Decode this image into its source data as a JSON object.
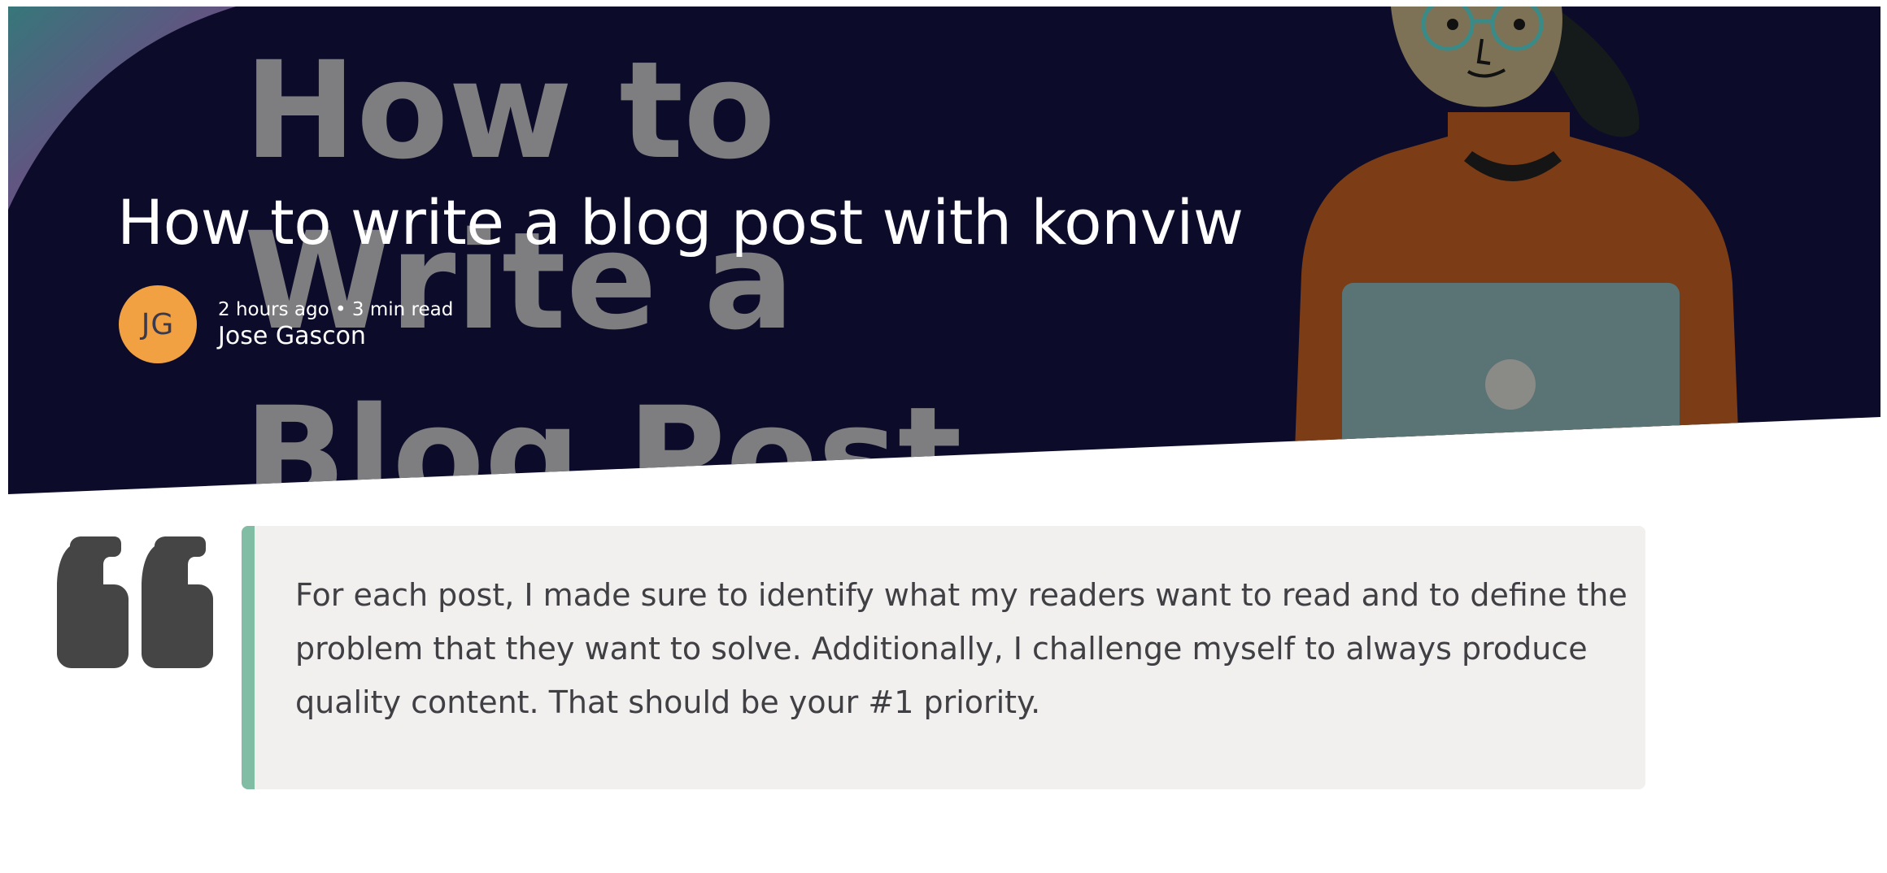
{
  "hero": {
    "background_image_text": [
      "How to",
      "Write a",
      "Blog Post"
    ],
    "title": "How to write a blog post with konviw",
    "background_color": "#0c0c2a"
  },
  "author": {
    "initials": "JG",
    "meta": "2 hours ago • 3 min read",
    "name": "Jose Gascon",
    "avatar_color": "#f2a142"
  },
  "quote": {
    "icon": "quote-icon",
    "text": "For each post, I made sure to identify what my readers want to read and to define the problem that they want to solve. Additionally, I challenge myself to always produce quality content. That should be your #1 priority.",
    "accent_color": "#81bca5",
    "background_color": "#f1f0ee"
  }
}
